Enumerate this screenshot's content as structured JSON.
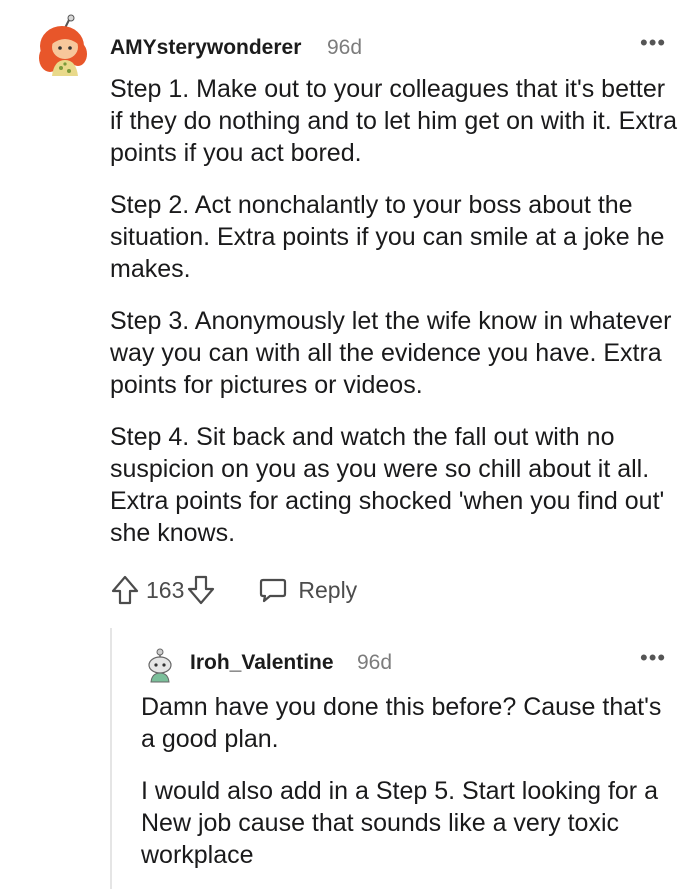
{
  "comment": {
    "author": "AMYsterywonderer",
    "age": "96d",
    "more": "•••",
    "paragraphs": [
      "Step 1. Make out to your colleagues that it's better if they do nothing and to let him get on with it. Extra points if you act bored.",
      "Step 2. Act nonchalantly to your boss about the situation. Extra points if you can smile at a joke he makes.",
      "Step 3. Anonymously let the wife know in whatever way you can with all the evidence you have. Extra points for pictures or videos.",
      "Step 4. Sit back and watch the fall out with no suspicion on you as you were so chill about it all. Extra points for acting shocked 'when you find out' she knows."
    ],
    "votes": "163",
    "reply_label": "Reply",
    "upvote_icon": "arrow-up-icon",
    "downvote_icon": "arrow-down-icon",
    "reply_icon": "speech-bubble-icon"
  },
  "reply": {
    "author": "Iroh_Valentine",
    "age": "96d",
    "more": "•••",
    "paragraphs": [
      "Damn have you done this before? Cause that's a good plan.",
      "I would also add in a Step 5. Start looking for a New job cause that sounds like a very toxic workplace"
    ]
  },
  "colors": {
    "text": "#1a1a1b",
    "meta": "#7c7c7c",
    "avatar_hair": "#e8562a",
    "thread_line": "#e5e5e5"
  }
}
